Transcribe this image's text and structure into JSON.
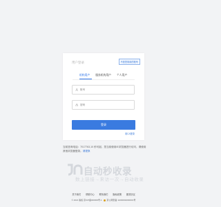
{
  "login": {
    "title": "用户登录",
    "corner_link": "不是您常用的账号",
    "tabs": [
      {
        "label": "机构用户",
        "active": true
      },
      {
        "label": "服务机构用户",
        "active": false
      },
      {
        "label": "个人用户",
        "active": false
      }
    ],
    "username_placeholder": "账号",
    "password_placeholder": "密码",
    "submit_label": "登录",
    "bottom_link": "用CA登录"
  },
  "notice": {
    "text": "当前咨询电话：7017763,10 秒可起，您当前使用IE浏览器进行访问，请使用其他浏览器登录。",
    "link_text": "请更换"
  },
  "logo": {
    "title": "自动秒收录",
    "subtitle": "数上链接→来访一次→自动收录"
  },
  "footer": {
    "links": [
      "关于我们",
      "帮助中心",
      "联系我们",
      "隐私政策",
      "服务协议"
    ],
    "copyright": "© 2021 版权  京ICP备000000号-1",
    "police": "京公网安备 11000002000001号"
  },
  "colors": {
    "accent": "#3a7be0",
    "background": "#f2f3f5",
    "logo_gray": "#d4d7dc"
  }
}
